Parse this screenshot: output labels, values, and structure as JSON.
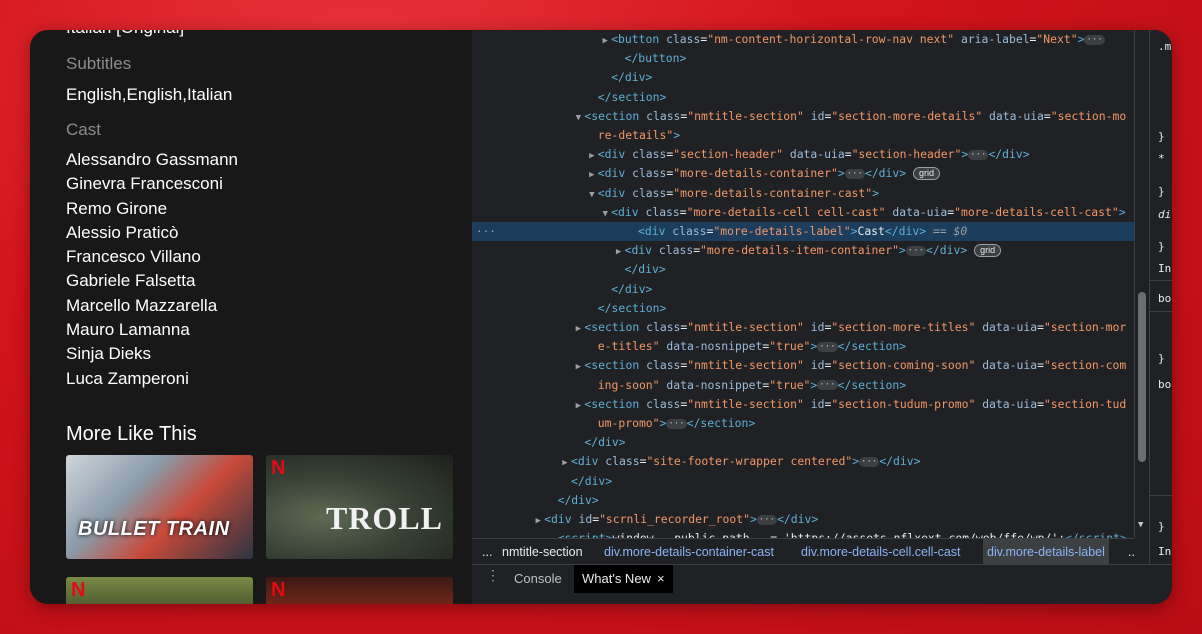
{
  "page": {
    "audio_cut": "Italian [Original]",
    "subtitles_label": "Subtitles",
    "subtitles_value": "English,English,Italian",
    "cast_label": "Cast",
    "cast": [
      "Alessandro Gassmann",
      "Ginevra Francesconi",
      "Remo Girone",
      "Alessio Praticò",
      "Francesco Villano",
      "Gabriele Falsetta",
      "Marcello Mazzarella",
      "Mauro Lamanna",
      "Sinja Dieks",
      "Luca Zamperoni"
    ],
    "more_like_this": "More Like This",
    "thumbs": [
      {
        "title": "BULLET TRAIN",
        "badge": ""
      },
      {
        "title": "TROLL",
        "badge": "N"
      },
      {
        "title": "",
        "badge": "N"
      },
      {
        "title": "",
        "badge": "N"
      }
    ]
  },
  "devtools": {
    "lines": [
      {
        "indent": 8,
        "tri": "▶",
        "html": "<span class='tag'>&lt;button</span> <span class='attr'>class</span>=<span class='aval'>\"nm-content-horizontal-row-nav next\"</span> <span class='attr'>aria-label</span>=<span class='aval'>\"Next\"</span><span class='tag'>&gt;</span><span class='dots'>···</span>"
      },
      {
        "indent": 9,
        "tri": "",
        "html": "<span class='tag'>&lt;/button&gt;</span>"
      },
      {
        "indent": 8,
        "tri": "",
        "html": "<span class='tag'>&lt;/div&gt;</span>"
      },
      {
        "indent": 7,
        "tri": "",
        "html": "<span class='tag'>&lt;/section&gt;</span>"
      },
      {
        "indent": 6,
        "tri": "▼",
        "html": "<span class='tag'>&lt;section</span> <span class='attr'>class</span>=<span class='aval'>\"nmtitle-section\"</span> <span class='attr'>id</span>=<span class='aval'>\"section-more-details\"</span> <span class='attr'>data-uia</span>=<span class='aval'>\"section-mo</span>"
      },
      {
        "indent": 7,
        "tri": "",
        "html": "<span class='aval'>re-details\"</span><span class='tag'>&gt;</span>"
      },
      {
        "indent": 7,
        "tri": "▶",
        "html": "<span class='tag'>&lt;div</span> <span class='attr'>class</span>=<span class='aval'>\"section-header\"</span> <span class='attr'>data-uia</span>=<span class='aval'>\"section-header\"</span><span class='tag'>&gt;</span><span class='dots'>···</span><span class='tag'>&lt;/div&gt;</span>"
      },
      {
        "indent": 7,
        "tri": "▶",
        "html": "<span class='tag'>&lt;div</span> <span class='attr'>class</span>=<span class='aval'>\"more-details-container\"</span><span class='tag'>&gt;</span><span class='dots'>···</span><span class='tag'>&lt;/div&gt;</span> <span class='badge'>grid</span>"
      },
      {
        "indent": 7,
        "tri": "▼",
        "html": "<span class='tag'>&lt;div</span> <span class='attr'>class</span>=<span class='aval'>\"more-details-container-cast\"</span><span class='tag'>&gt;</span>"
      },
      {
        "indent": 8,
        "tri": "▼",
        "html": "<span class='tag'>&lt;div</span> <span class='attr'>class</span>=<span class='aval'>\"more-details-cell cell-cast\"</span> <span class='attr'>data-uia</span>=<span class='aval'>\"more-details-cell-cast\"</span><span class='tag'>&gt;</span>"
      },
      {
        "indent": 10,
        "tri": "",
        "sel": true,
        "html": "<span class='tag'>&lt;div</span> <span class='attr'>class</span>=<span class='aval'>\"more-details-label\"</span><span class='tag'>&gt;</span><span class='txt'>Cast</span><span class='tag'>&lt;/div&gt;</span> <span class='eq'>== $0</span>"
      },
      {
        "indent": 9,
        "tri": "▶",
        "html": "<span class='tag'>&lt;div</span> <span class='attr'>class</span>=<span class='aval'>\"more-details-item-container\"</span><span class='tag'>&gt;</span><span class='dots'>···</span><span class='tag'>&lt;/div&gt;</span> <span class='badge'>grid</span>"
      },
      {
        "indent": 9,
        "tri": "",
        "html": "<span class='tag'>&lt;/div&gt;</span>"
      },
      {
        "indent": 8,
        "tri": "",
        "html": "<span class='tag'>&lt;/div&gt;</span>"
      },
      {
        "indent": 7,
        "tri": "",
        "html": "<span class='tag'>&lt;/section&gt;</span>"
      },
      {
        "indent": 6,
        "tri": "▶",
        "html": "<span class='tag'>&lt;section</span> <span class='attr'>class</span>=<span class='aval'>\"nmtitle-section\"</span> <span class='attr'>id</span>=<span class='aval'>\"section-more-titles\"</span> <span class='attr'>data-uia</span>=<span class='aval'>\"section-mor</span>"
      },
      {
        "indent": 7,
        "tri": "",
        "html": "<span class='aval'>e-titles\"</span> <span class='attr'>data-nosnippet</span>=<span class='aval'>\"true\"</span><span class='tag'>&gt;</span><span class='dots'>···</span><span class='tag'>&lt;/section&gt;</span>"
      },
      {
        "indent": 6,
        "tri": "▶",
        "html": "<span class='tag'>&lt;section</span> <span class='attr'>class</span>=<span class='aval'>\"nmtitle-section\"</span> <span class='attr'>id</span>=<span class='aval'>\"section-coming-soon\"</span> <span class='attr'>data-uia</span>=<span class='aval'>\"section-com</span>"
      },
      {
        "indent": 7,
        "tri": "",
        "html": "<span class='aval'>ing-soon\"</span> <span class='attr'>data-nosnippet</span>=<span class='aval'>\"true\"</span><span class='tag'>&gt;</span><span class='dots'>···</span><span class='tag'>&lt;/section&gt;</span>"
      },
      {
        "indent": 6,
        "tri": "▶",
        "html": "<span class='tag'>&lt;section</span> <span class='attr'>class</span>=<span class='aval'>\"nmtitle-section\"</span> <span class='attr'>id</span>=<span class='aval'>\"section-tudum-promo\"</span> <span class='attr'>data-uia</span>=<span class='aval'>\"section-tud</span>"
      },
      {
        "indent": 7,
        "tri": "",
        "html": "<span class='aval'>um-promo\"</span><span class='tag'>&gt;</span><span class='dots'>···</span><span class='tag'>&lt;/section&gt;</span>"
      },
      {
        "indent": 6,
        "tri": "",
        "html": "<span class='tag'>&lt;/div&gt;</span>"
      },
      {
        "indent": 5,
        "tri": "▶",
        "html": "<span class='tag'>&lt;div</span> <span class='attr'>class</span>=<span class='aval'>\"site-footer-wrapper centered\"</span><span class='tag'>&gt;</span><span class='dots'>···</span><span class='tag'>&lt;/div&gt;</span>"
      },
      {
        "indent": 5,
        "tri": "",
        "html": "<span class='tag'>&lt;/div&gt;</span>"
      },
      {
        "indent": 4,
        "tri": "",
        "html": "<span class='tag'>&lt;/div&gt;</span>"
      },
      {
        "indent": 3,
        "tri": "▶",
        "html": "<span class='tag'>&lt;div</span> <span class='attr'>id</span>=<span class='aval'>\"scrnli_recorder_root\"</span><span class='tag'>&gt;</span><span class='dots'>···</span><span class='tag'>&lt;/div&gt;</span>"
      },
      {
        "indent": 4,
        "tri": "",
        "html": "<span class='tag'>&lt;script&gt;</span><span class='txt'>window.__public_path__ = 'https://assets.nflxext.com/web/ffe/wp/';</span><span class='tag'>&lt;/script&gt;</span>"
      }
    ],
    "styles_glyphs": [
      ".m",
      "}",
      "*",
      "}",
      "di",
      "}",
      "Inl",
      "bo",
      "}",
      "bo",
      "}",
      "Inl"
    ],
    "breadcrumb": {
      "leading": "...",
      "items": [
        "nmtitle-section",
        "div.more-details-container-cast",
        "div.more-details-cell.cell-cast",
        "div.more-details-label"
      ],
      "trailing": "..."
    },
    "drawer": {
      "tabs": [
        "Console",
        "What's New"
      ],
      "close": "×"
    }
  },
  "colors": {
    "accent_red": "#e50914",
    "selection": "#1c3d5c",
    "tag": "#5db0d7",
    "attr_value": "#f29766"
  }
}
